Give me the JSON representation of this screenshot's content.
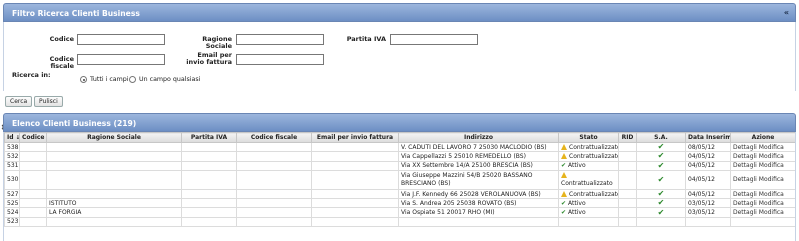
{
  "filter": {
    "title": "Filtro Ricerca Clienti Business",
    "collapse": "«",
    "codice_label": "Codice",
    "ragione_sociale_label": "Ragione Sociale",
    "partita_iva_label": "Partita IVA",
    "codice_fiscale_label": "Codice fiscale",
    "email_label": "Email per invio fattura",
    "ricerca_label": "Ricerca in:",
    "radio_all": "Tutti i campi",
    "radio_any": "Un campo qualsiasi",
    "codice_value": "",
    "ragione_sociale_value": "",
    "partita_iva_value": "",
    "codice_fiscale_value": "",
    "email_value": ""
  },
  "buttons": {
    "search": "Cerca",
    "clear": "Pulisci"
  },
  "list": {
    "title": "Elenco Clienti Business (219)",
    "columns": {
      "id": "Id",
      "sort": "↓",
      "codice": "Codice",
      "ragione_sociale": "Ragione Sociale",
      "partita_iva": "Partita IVA",
      "codice_fiscale": "Codice fiscale",
      "email": "Email per invio fattura",
      "indirizzo": "Indirizzo",
      "stato": "Stato",
      "rid": "RID",
      "sa": "S.A.",
      "data": "Data Inserimento",
      "azione": "Azione"
    },
    "rows": [
      {
        "id": "538",
        "codice": "",
        "ragione": "",
        "indirizzo": "V. CADUTI DEL LAVORO 7 25030 MACLODIO (BS)",
        "stato": "Contrattualizzato",
        "stato_kind": "warn",
        "data": "08/05/12",
        "det": "Dettagli",
        "mod": "Modifica"
      },
      {
        "id": "532",
        "codice": "",
        "ragione": "",
        "indirizzo": "Via Cappellazzi 5 25010 REMEDELLO (BS)",
        "stato": "Contrattualizzato",
        "stato_kind": "warn",
        "data": "04/05/12",
        "det": "Dettagli",
        "mod": "Modifica"
      },
      {
        "id": "531",
        "codice": "",
        "ragione": "",
        "indirizzo": "Via XX Settembre 14/A 25100 BRESCIA (BS)",
        "stato": "Attivo",
        "stato_kind": "ok",
        "data": "04/05/12",
        "det": "Dettagli",
        "mod": "Modifica"
      },
      {
        "id": "530",
        "codice": "",
        "ragione": "",
        "indirizzo": "Via Giuseppe Mazzini 54/B 25020 BASSANO BRESCIANO (BS)",
        "stato": "Contrattualizzato",
        "stato_kind": "warn",
        "data": "04/05/12",
        "det": "Dettagli",
        "mod": "Modifica",
        "tall": true
      },
      {
        "id": "527",
        "codice": "",
        "ragione": "",
        "indirizzo": "Via J.F. Kennedy 66 25028 VEROLANUOVA (BS)",
        "stato": "Contrattualizzato",
        "stato_kind": "warn",
        "data": "04/05/12",
        "det": "Dettagli",
        "mod": "Modifica"
      },
      {
        "id": "525",
        "codice": "",
        "ragione": "ISTITUTO",
        "indirizzo": "Via S. Andrea 205 25038 ROVATO (BS)",
        "stato": "Attivo",
        "stato_kind": "ok",
        "data": "03/05/12",
        "det": "Dettagli",
        "mod": "Modifica"
      },
      {
        "id": "524",
        "codice": "",
        "ragione": "LA FORGIA",
        "indirizzo": "Via Ospiate 51 20017 RHO (MI)",
        "stato": "Attivo",
        "stato_kind": "ok",
        "data": "03/05/12",
        "det": "Dettagli",
        "mod": "Modifica"
      },
      {
        "id": "523",
        "codice": "",
        "ragione": "",
        "indirizzo": "",
        "stato": "",
        "stato_kind": "none",
        "data": "",
        "det": "",
        "mod": ""
      }
    ]
  },
  "colors": {
    "header_top": "#9cb6dd",
    "header_bottom": "#6d8fc4",
    "ok": "#2f8a2f",
    "warn": "#e6b41d"
  }
}
